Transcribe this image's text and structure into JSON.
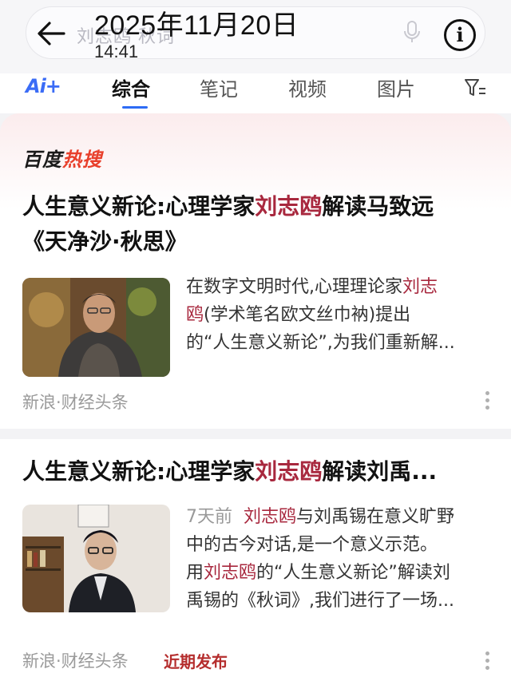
{
  "header": {
    "search_query": "刘志鸥 秋词",
    "date_stamp": "2025年11月20日",
    "time_stamp": "14:41",
    "info_glyph": "i",
    "icons": [
      "back-arrow-icon",
      "microphone-icon",
      "info-icon"
    ]
  },
  "tabs": {
    "ai_label": "Ai+",
    "items": [
      "综合",
      "笔记",
      "视频",
      "图片"
    ],
    "active": "综合",
    "filter_icon": "filter-icon"
  },
  "hot_search": {
    "brand_prefix": "百度",
    "brand_hot": "热搜"
  },
  "results": [
    {
      "title_line1_pre": "人生意义新论:心理学家",
      "title_line1_name": "刘志鸥",
      "title_line1_post": "解读马致远",
      "title_line2": "《天净沙·秋思》",
      "desc_pre": "在数字文明时代,心理理论家",
      "desc_name_a": "刘志",
      "desc_name_b": "鸥",
      "desc_line2_rest": "(学术笔名欧文丝巾衲)提出",
      "desc_line3": "的“人生意义新论”,为我们重新解...",
      "source": "新浪·财经头条"
    },
    {
      "title_pre": "人生意义新论:心理学家",
      "title_name": "刘志鸥",
      "title_post": "解读刘禹...",
      "time": "7天前",
      "desc_name": "刘志鸥",
      "desc_line1_rest": "与刘禹锡在意义旷野",
      "desc_line2": "中的古今对话,是一个意义示范。",
      "desc_line3_pre": "用",
      "desc_line3_name": "刘志鸥",
      "desc_line3_post": "的“人生意义新论”解读刘",
      "desc_line4": "禹锡的《秋词》,我们进行了一场...",
      "source": "新浪·财经头条",
      "badge": "近期发布"
    }
  ],
  "colors": {
    "accent_blue": "#2d6bf5",
    "highlight_red": "#a8283e",
    "hot_red": "#e8402c"
  }
}
